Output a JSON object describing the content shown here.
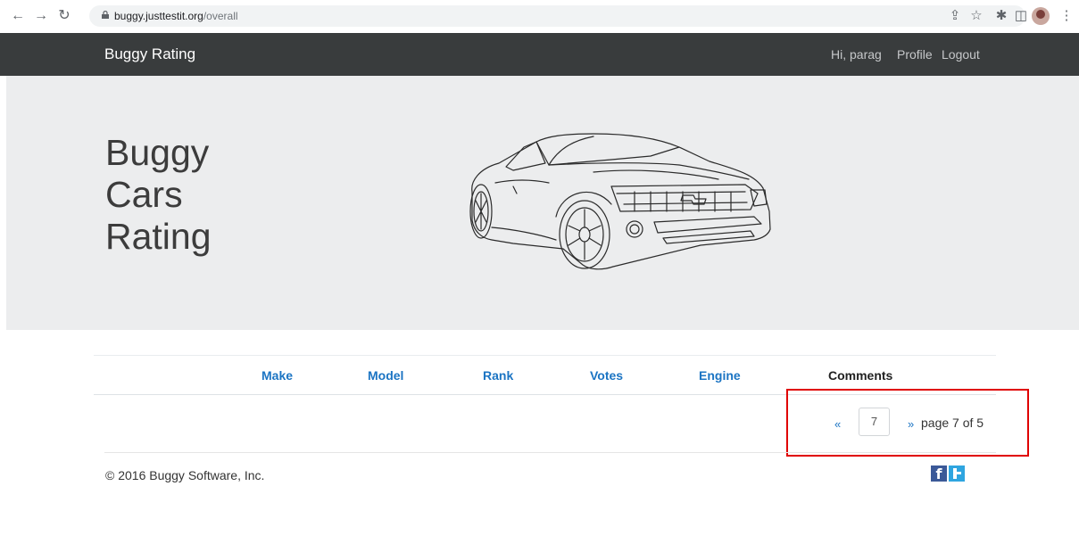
{
  "browser": {
    "url_host": "buggy.justtestit.org",
    "url_path": "/overall",
    "icons": [
      "back-icon",
      "forward-icon",
      "reload-icon",
      "lock-icon",
      "share-icon",
      "star-icon",
      "extensions-icon",
      "sidepanel-icon",
      "profile-avatar",
      "menu-icon"
    ]
  },
  "navbar": {
    "brand": "Buggy Rating",
    "greeting": "Hi, parag",
    "profile": "Profile",
    "logout": "Logout"
  },
  "hero": {
    "title_lines": [
      "Buggy",
      "Cars",
      "Rating"
    ]
  },
  "table": {
    "columns": [
      "Make",
      "Model",
      "Rank",
      "Votes",
      "Engine",
      "Comments"
    ]
  },
  "pagination": {
    "prev": "«",
    "next": "»",
    "page_value": "7",
    "info": "page 7 of 5"
  },
  "footer": {
    "copyright": "© 2016 Buggy Software, Inc.",
    "social": [
      "facebook-icon",
      "twitter-icon"
    ]
  },
  "colors": {
    "navbar_bg": "#393c3d",
    "link_blue": "#1b74c3",
    "hero_bg": "#ecedee",
    "highlight_red": "#e00000"
  }
}
